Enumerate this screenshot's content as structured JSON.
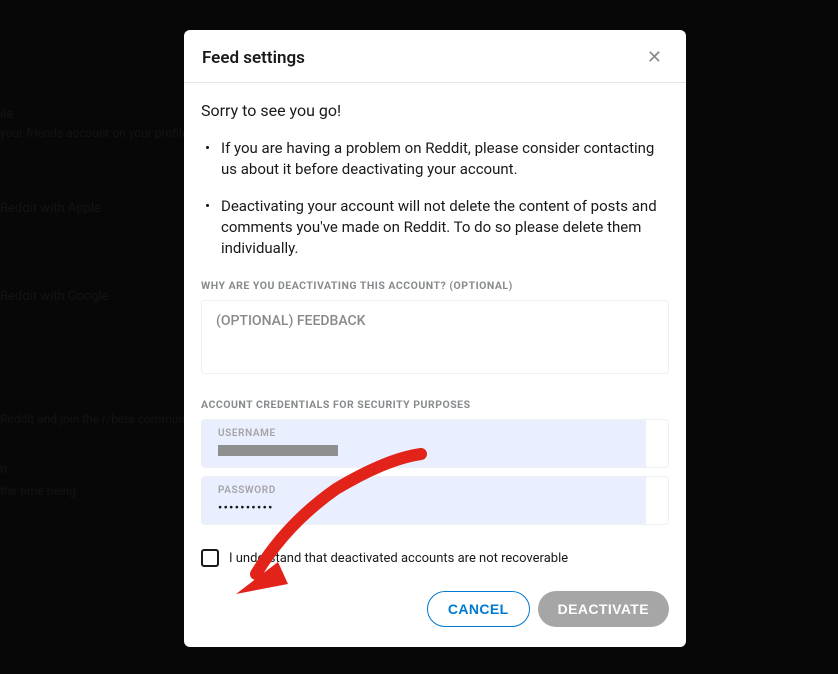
{
  "background": {
    "profile": "ile",
    "profile_sub": "your friends account on your profile",
    "apple": "Reddit with Apple",
    "google": "Reddit with Google",
    "beta": "Reddit and join the r/beta community",
    "n": "n",
    "time_being": "the time being"
  },
  "modal": {
    "title": "Feed settings",
    "sorry": "Sorry to see you go!",
    "bullet1": "If you are having a problem on Reddit, please consider contacting us about it before deactivating your account.",
    "bullet2": "Deactivating your account will not delete the content of posts and comments you've made on Reddit. To do so please delete them individually.",
    "why_label": "WHY ARE YOU DEACTIVATING THIS ACCOUNT? (OPTIONAL)",
    "feedback_placeholder": "(OPTIONAL) FEEDBACK",
    "credentials_label": "ACCOUNT CREDENTIALS FOR SECURITY PURPOSES",
    "username_label": "USERNAME",
    "password_label": "PASSWORD",
    "password_value": "••••••••••",
    "checkbox_text": "I understand that deactivated accounts are not recoverable",
    "cancel": "CANCEL",
    "deactivate": "DEACTIVATE"
  }
}
